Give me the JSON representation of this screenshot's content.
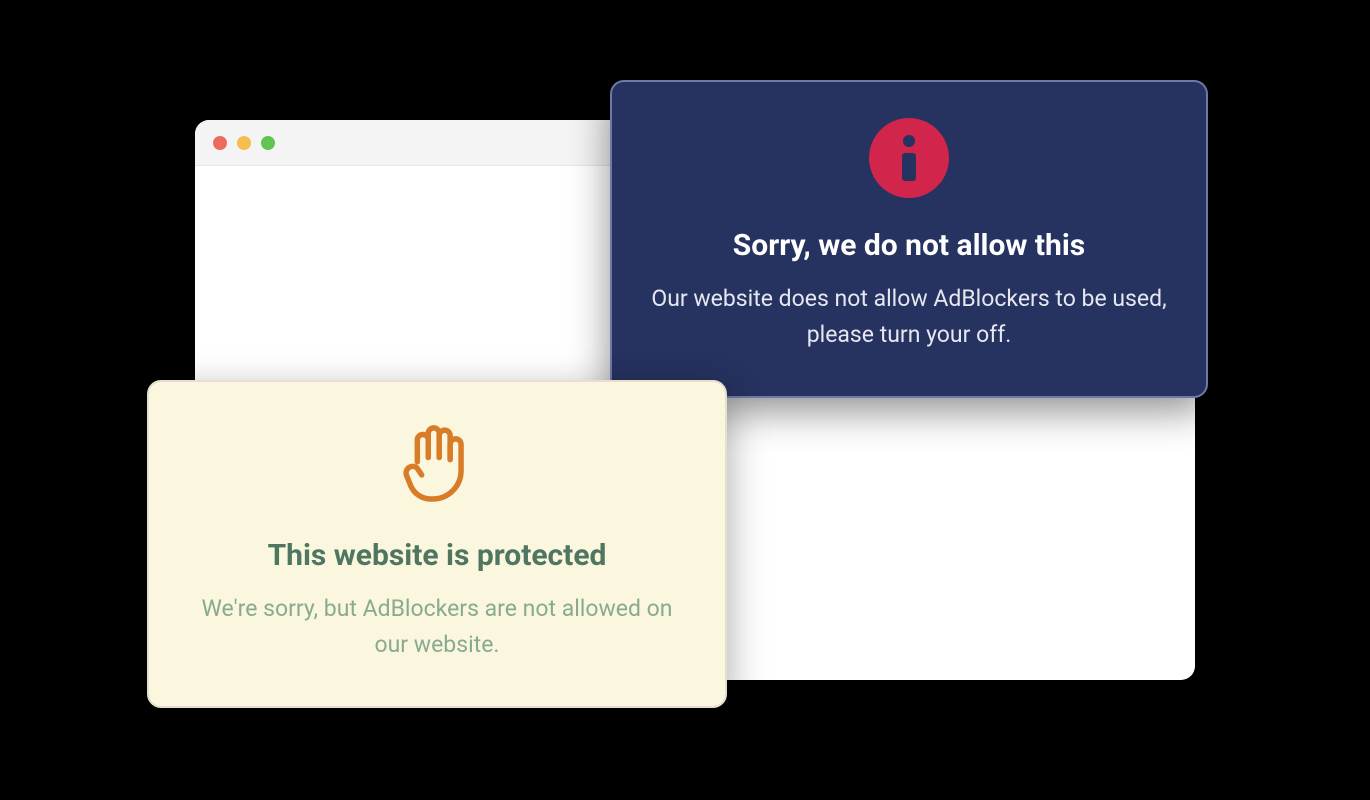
{
  "dark_dialog": {
    "title": "Sorry, we do not allow this",
    "body": "Our website does not allow AdBlockers to be used, please turn your off."
  },
  "cream_dialog": {
    "title": "This website is protected",
    "body": "We're sorry, but AdBlockers are not allowed on our website."
  },
  "colors": {
    "navy": "#26325f",
    "crimson": "#d1254b",
    "cream": "#fbf6de",
    "sage": "#4e7660",
    "orange": "#d97c27"
  }
}
